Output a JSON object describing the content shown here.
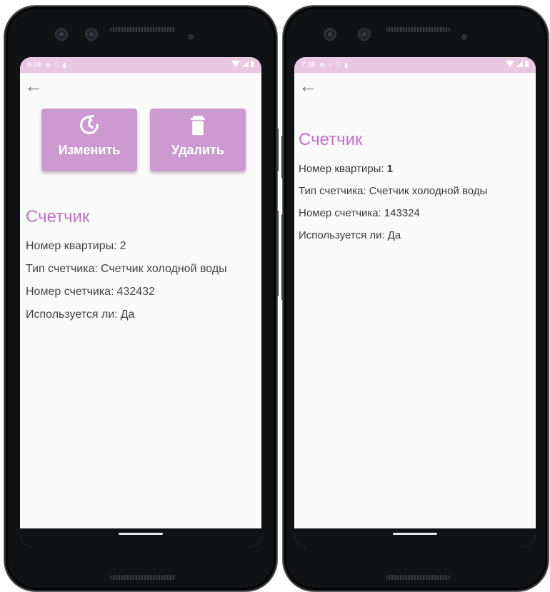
{
  "left": {
    "status": {
      "time": "6:48"
    },
    "back_label": "←",
    "buttons": {
      "edit": "Изменить",
      "delete": "Удалить"
    },
    "title": "Счетчик",
    "fields": [
      {
        "label": "Номер квартиры:",
        "value": "2"
      },
      {
        "label": "Тип счетчика:",
        "value": "Счетчик холодной воды"
      },
      {
        "label": "Номер счетчика:",
        "value": "432432"
      },
      {
        "label": "Используется ли:",
        "value": "Да"
      }
    ]
  },
  "right": {
    "status": {
      "time": "7:38"
    },
    "back_label": "←",
    "title": "Счетчик",
    "fields": [
      {
        "label": "Номер квартиры:",
        "value": "1"
      },
      {
        "label": "Тип счетчика:",
        "value": "Счетчик холодной воды"
      },
      {
        "label": "Номер счетчика:",
        "value": "143324"
      },
      {
        "label": "Используется ли:",
        "value": "Да"
      }
    ]
  },
  "colors": {
    "accent": "#c071c7",
    "button_bg": "#cc99d0",
    "status_bar": "#e9c8e4"
  },
  "icons": {
    "edit": "history-icon",
    "delete": "trash-icon",
    "back": "arrow-left-icon"
  }
}
